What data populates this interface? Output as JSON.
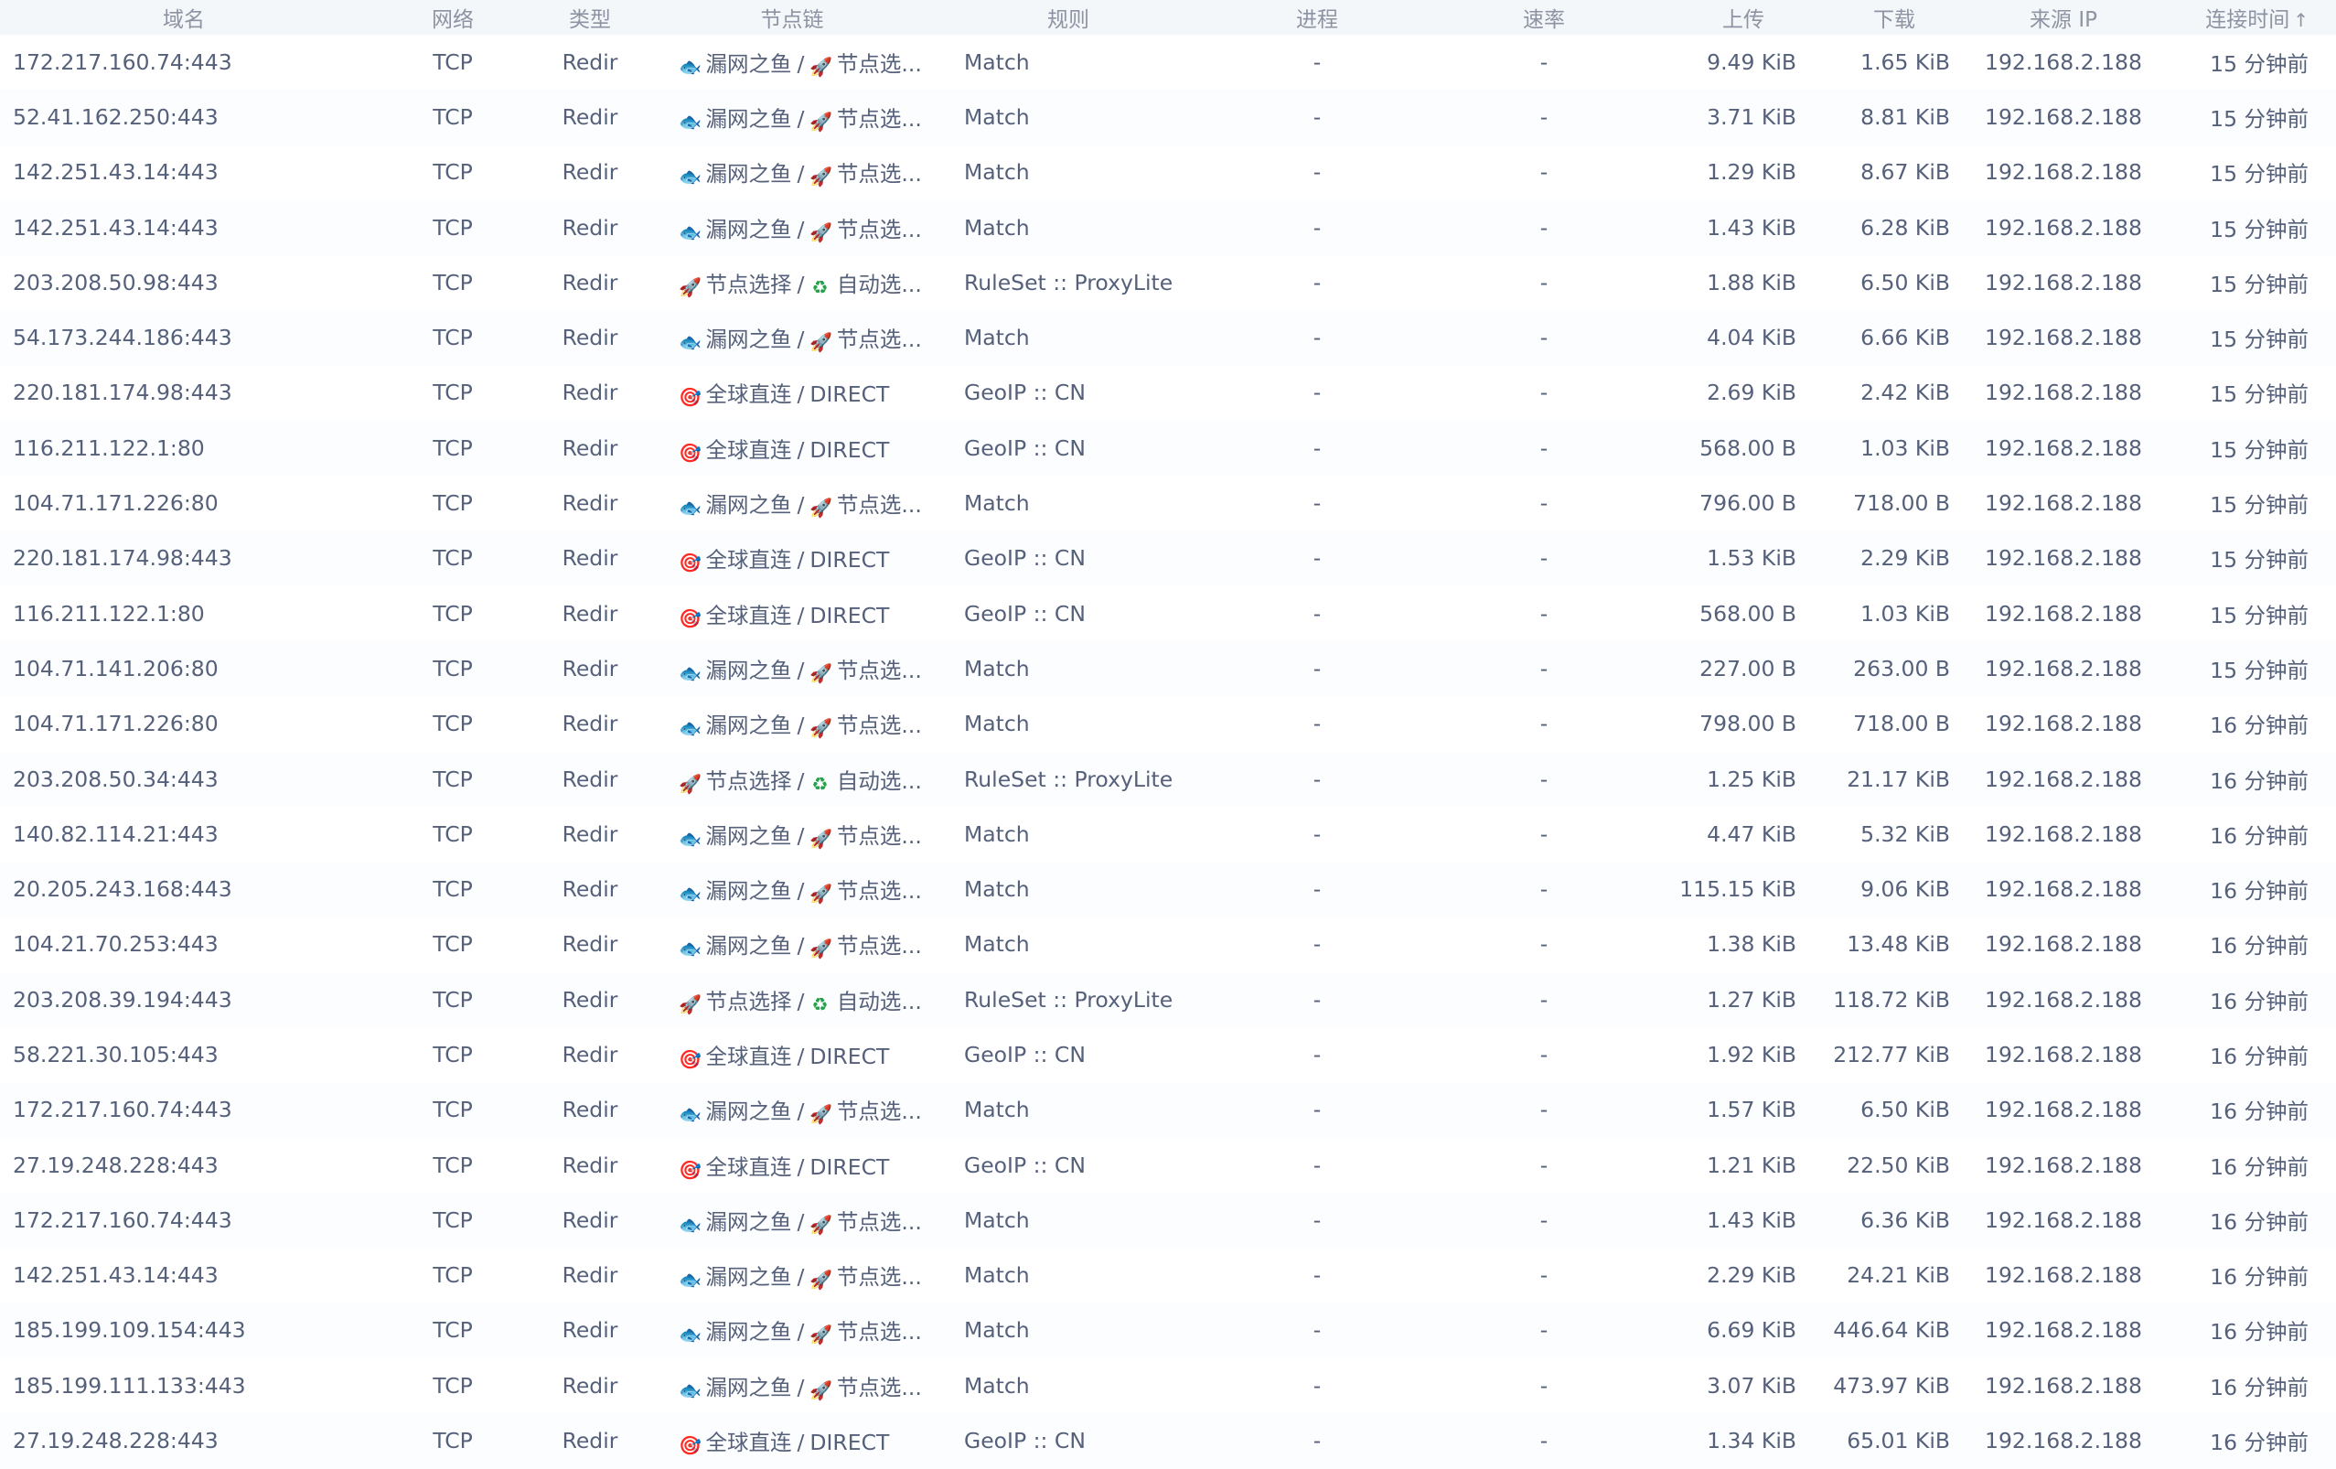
{
  "headers": {
    "host": "域名",
    "network": "网络",
    "type": "类型",
    "chain": "节点链",
    "rule": "规则",
    "process": "进程",
    "speed": "速率",
    "upload": "上传",
    "download": "下载",
    "source_ip": "来源 IP",
    "connected": "连接时间",
    "sort_indicator": "↑"
  },
  "icons": {
    "fish": "fish-icon",
    "rocket": "rocket-icon",
    "target": "target-icon",
    "recycle": "recycle-icon"
  },
  "rows": [
    {
      "host": "172.217.160.74:443",
      "network": "TCP",
      "type": "Redir",
      "chain": [
        {
          "icon": "fish",
          "label": "漏网之鱼"
        },
        {
          "icon": "rocket",
          "label": "节点选..."
        }
      ],
      "rule": "Match",
      "process": "-",
      "speed": "-",
      "upload": "9.49 KiB",
      "download": "1.65 KiB",
      "source": "192.168.2.188",
      "time": "15 分钟前"
    },
    {
      "host": "52.41.162.250:443",
      "network": "TCP",
      "type": "Redir",
      "chain": [
        {
          "icon": "fish",
          "label": "漏网之鱼"
        },
        {
          "icon": "rocket",
          "label": "节点选..."
        }
      ],
      "rule": "Match",
      "process": "-",
      "speed": "-",
      "upload": "3.71 KiB",
      "download": "8.81 KiB",
      "source": "192.168.2.188",
      "time": "15 分钟前"
    },
    {
      "host": "142.251.43.14:443",
      "network": "TCP",
      "type": "Redir",
      "chain": [
        {
          "icon": "fish",
          "label": "漏网之鱼"
        },
        {
          "icon": "rocket",
          "label": "节点选..."
        }
      ],
      "rule": "Match",
      "process": "-",
      "speed": "-",
      "upload": "1.29 KiB",
      "download": "8.67 KiB",
      "source": "192.168.2.188",
      "time": "15 分钟前"
    },
    {
      "host": "142.251.43.14:443",
      "network": "TCP",
      "type": "Redir",
      "chain": [
        {
          "icon": "fish",
          "label": "漏网之鱼"
        },
        {
          "icon": "rocket",
          "label": "节点选..."
        }
      ],
      "rule": "Match",
      "process": "-",
      "speed": "-",
      "upload": "1.43 KiB",
      "download": "6.28 KiB",
      "source": "192.168.2.188",
      "time": "15 分钟前"
    },
    {
      "host": "203.208.50.98:443",
      "network": "TCP",
      "type": "Redir",
      "chain": [
        {
          "icon": "rocket",
          "label": "节点选择"
        },
        {
          "icon": "recycle",
          "label": "自动选..."
        }
      ],
      "rule": "RuleSet :: ProxyLite",
      "process": "-",
      "speed": "-",
      "upload": "1.88 KiB",
      "download": "6.50 KiB",
      "source": "192.168.2.188",
      "time": "15 分钟前"
    },
    {
      "host": "54.173.244.186:443",
      "network": "TCP",
      "type": "Redir",
      "chain": [
        {
          "icon": "fish",
          "label": "漏网之鱼"
        },
        {
          "icon": "rocket",
          "label": "节点选..."
        }
      ],
      "rule": "Match",
      "process": "-",
      "speed": "-",
      "upload": "4.04 KiB",
      "download": "6.66 KiB",
      "source": "192.168.2.188",
      "time": "15 分钟前"
    },
    {
      "host": "220.181.174.98:443",
      "network": "TCP",
      "type": "Redir",
      "chain": [
        {
          "icon": "target",
          "label": "全球直连"
        },
        {
          "icon": "",
          "label": "DIRECT"
        }
      ],
      "rule": "GeoIP :: CN",
      "process": "-",
      "speed": "-",
      "upload": "2.69 KiB",
      "download": "2.42 KiB",
      "source": "192.168.2.188",
      "time": "15 分钟前"
    },
    {
      "host": "116.211.122.1:80",
      "network": "TCP",
      "type": "Redir",
      "chain": [
        {
          "icon": "target",
          "label": "全球直连"
        },
        {
          "icon": "",
          "label": "DIRECT"
        }
      ],
      "rule": "GeoIP :: CN",
      "process": "-",
      "speed": "-",
      "upload": "568.00 B",
      "download": "1.03 KiB",
      "source": "192.168.2.188",
      "time": "15 分钟前"
    },
    {
      "host": "104.71.171.226:80",
      "network": "TCP",
      "type": "Redir",
      "chain": [
        {
          "icon": "fish",
          "label": "漏网之鱼"
        },
        {
          "icon": "rocket",
          "label": "节点选..."
        }
      ],
      "rule": "Match",
      "process": "-",
      "speed": "-",
      "upload": "796.00 B",
      "download": "718.00 B",
      "source": "192.168.2.188",
      "time": "15 分钟前"
    },
    {
      "host": "220.181.174.98:443",
      "network": "TCP",
      "type": "Redir",
      "chain": [
        {
          "icon": "target",
          "label": "全球直连"
        },
        {
          "icon": "",
          "label": "DIRECT"
        }
      ],
      "rule": "GeoIP :: CN",
      "process": "-",
      "speed": "-",
      "upload": "1.53 KiB",
      "download": "2.29 KiB",
      "source": "192.168.2.188",
      "time": "15 分钟前"
    },
    {
      "host": "116.211.122.1:80",
      "network": "TCP",
      "type": "Redir",
      "chain": [
        {
          "icon": "target",
          "label": "全球直连"
        },
        {
          "icon": "",
          "label": "DIRECT"
        }
      ],
      "rule": "GeoIP :: CN",
      "process": "-",
      "speed": "-",
      "upload": "568.00 B",
      "download": "1.03 KiB",
      "source": "192.168.2.188",
      "time": "15 分钟前"
    },
    {
      "host": "104.71.141.206:80",
      "network": "TCP",
      "type": "Redir",
      "chain": [
        {
          "icon": "fish",
          "label": "漏网之鱼"
        },
        {
          "icon": "rocket",
          "label": "节点选..."
        }
      ],
      "rule": "Match",
      "process": "-",
      "speed": "-",
      "upload": "227.00 B",
      "download": "263.00 B",
      "source": "192.168.2.188",
      "time": "15 分钟前"
    },
    {
      "host": "104.71.171.226:80",
      "network": "TCP",
      "type": "Redir",
      "chain": [
        {
          "icon": "fish",
          "label": "漏网之鱼"
        },
        {
          "icon": "rocket",
          "label": "节点选..."
        }
      ],
      "rule": "Match",
      "process": "-",
      "speed": "-",
      "upload": "798.00 B",
      "download": "718.00 B",
      "source": "192.168.2.188",
      "time": "16 分钟前"
    },
    {
      "host": "203.208.50.34:443",
      "network": "TCP",
      "type": "Redir",
      "chain": [
        {
          "icon": "rocket",
          "label": "节点选择"
        },
        {
          "icon": "recycle",
          "label": "自动选..."
        }
      ],
      "rule": "RuleSet :: ProxyLite",
      "process": "-",
      "speed": "-",
      "upload": "1.25 KiB",
      "download": "21.17 KiB",
      "source": "192.168.2.188",
      "time": "16 分钟前"
    },
    {
      "host": "140.82.114.21:443",
      "network": "TCP",
      "type": "Redir",
      "chain": [
        {
          "icon": "fish",
          "label": "漏网之鱼"
        },
        {
          "icon": "rocket",
          "label": "节点选..."
        }
      ],
      "rule": "Match",
      "process": "-",
      "speed": "-",
      "upload": "4.47 KiB",
      "download": "5.32 KiB",
      "source": "192.168.2.188",
      "time": "16 分钟前"
    },
    {
      "host": "20.205.243.168:443",
      "network": "TCP",
      "type": "Redir",
      "chain": [
        {
          "icon": "fish",
          "label": "漏网之鱼"
        },
        {
          "icon": "rocket",
          "label": "节点选..."
        }
      ],
      "rule": "Match",
      "process": "-",
      "speed": "-",
      "upload": "115.15 KiB",
      "download": "9.06 KiB",
      "source": "192.168.2.188",
      "time": "16 分钟前"
    },
    {
      "host": "104.21.70.253:443",
      "network": "TCP",
      "type": "Redir",
      "chain": [
        {
          "icon": "fish",
          "label": "漏网之鱼"
        },
        {
          "icon": "rocket",
          "label": "节点选..."
        }
      ],
      "rule": "Match",
      "process": "-",
      "speed": "-",
      "upload": "1.38 KiB",
      "download": "13.48 KiB",
      "source": "192.168.2.188",
      "time": "16 分钟前"
    },
    {
      "host": "203.208.39.194:443",
      "network": "TCP",
      "type": "Redir",
      "chain": [
        {
          "icon": "rocket",
          "label": "节点选择"
        },
        {
          "icon": "recycle",
          "label": "自动选..."
        }
      ],
      "rule": "RuleSet :: ProxyLite",
      "process": "-",
      "speed": "-",
      "upload": "1.27 KiB",
      "download": "118.72 KiB",
      "source": "192.168.2.188",
      "time": "16 分钟前"
    },
    {
      "host": "58.221.30.105:443",
      "network": "TCP",
      "type": "Redir",
      "chain": [
        {
          "icon": "target",
          "label": "全球直连"
        },
        {
          "icon": "",
          "label": "DIRECT"
        }
      ],
      "rule": "GeoIP :: CN",
      "process": "-",
      "speed": "-",
      "upload": "1.92 KiB",
      "download": "212.77 KiB",
      "source": "192.168.2.188",
      "time": "16 分钟前"
    },
    {
      "host": "172.217.160.74:443",
      "network": "TCP",
      "type": "Redir",
      "chain": [
        {
          "icon": "fish",
          "label": "漏网之鱼"
        },
        {
          "icon": "rocket",
          "label": "节点选..."
        }
      ],
      "rule": "Match",
      "process": "-",
      "speed": "-",
      "upload": "1.57 KiB",
      "download": "6.50 KiB",
      "source": "192.168.2.188",
      "time": "16 分钟前"
    },
    {
      "host": "27.19.248.228:443",
      "network": "TCP",
      "type": "Redir",
      "chain": [
        {
          "icon": "target",
          "label": "全球直连"
        },
        {
          "icon": "",
          "label": "DIRECT"
        }
      ],
      "rule": "GeoIP :: CN",
      "process": "-",
      "speed": "-",
      "upload": "1.21 KiB",
      "download": "22.50 KiB",
      "source": "192.168.2.188",
      "time": "16 分钟前"
    },
    {
      "host": "172.217.160.74:443",
      "network": "TCP",
      "type": "Redir",
      "chain": [
        {
          "icon": "fish",
          "label": "漏网之鱼"
        },
        {
          "icon": "rocket",
          "label": "节点选..."
        }
      ],
      "rule": "Match",
      "process": "-",
      "speed": "-",
      "upload": "1.43 KiB",
      "download": "6.36 KiB",
      "source": "192.168.2.188",
      "time": "16 分钟前"
    },
    {
      "host": "142.251.43.14:443",
      "network": "TCP",
      "type": "Redir",
      "chain": [
        {
          "icon": "fish",
          "label": "漏网之鱼"
        },
        {
          "icon": "rocket",
          "label": "节点选..."
        }
      ],
      "rule": "Match",
      "process": "-",
      "speed": "-",
      "upload": "2.29 KiB",
      "download": "24.21 KiB",
      "source": "192.168.2.188",
      "time": "16 分钟前"
    },
    {
      "host": "185.199.109.154:443",
      "network": "TCP",
      "type": "Redir",
      "chain": [
        {
          "icon": "fish",
          "label": "漏网之鱼"
        },
        {
          "icon": "rocket",
          "label": "节点选..."
        }
      ],
      "rule": "Match",
      "process": "-",
      "speed": "-",
      "upload": "6.69 KiB",
      "download": "446.64 KiB",
      "source": "192.168.2.188",
      "time": "16 分钟前"
    },
    {
      "host": "185.199.111.133:443",
      "network": "TCP",
      "type": "Redir",
      "chain": [
        {
          "icon": "fish",
          "label": "漏网之鱼"
        },
        {
          "icon": "rocket",
          "label": "节点选..."
        }
      ],
      "rule": "Match",
      "process": "-",
      "speed": "-",
      "upload": "3.07 KiB",
      "download": "473.97 KiB",
      "source": "192.168.2.188",
      "time": "16 分钟前"
    },
    {
      "host": "27.19.248.228:443",
      "network": "TCP",
      "type": "Redir",
      "chain": [
        {
          "icon": "target",
          "label": "全球直连"
        },
        {
          "icon": "",
          "label": "DIRECT"
        }
      ],
      "rule": "GeoIP :: CN",
      "process": "-",
      "speed": "-",
      "upload": "1.34 KiB",
      "download": "65.01 KiB",
      "source": "192.168.2.188",
      "time": "16 分钟前"
    }
  ]
}
